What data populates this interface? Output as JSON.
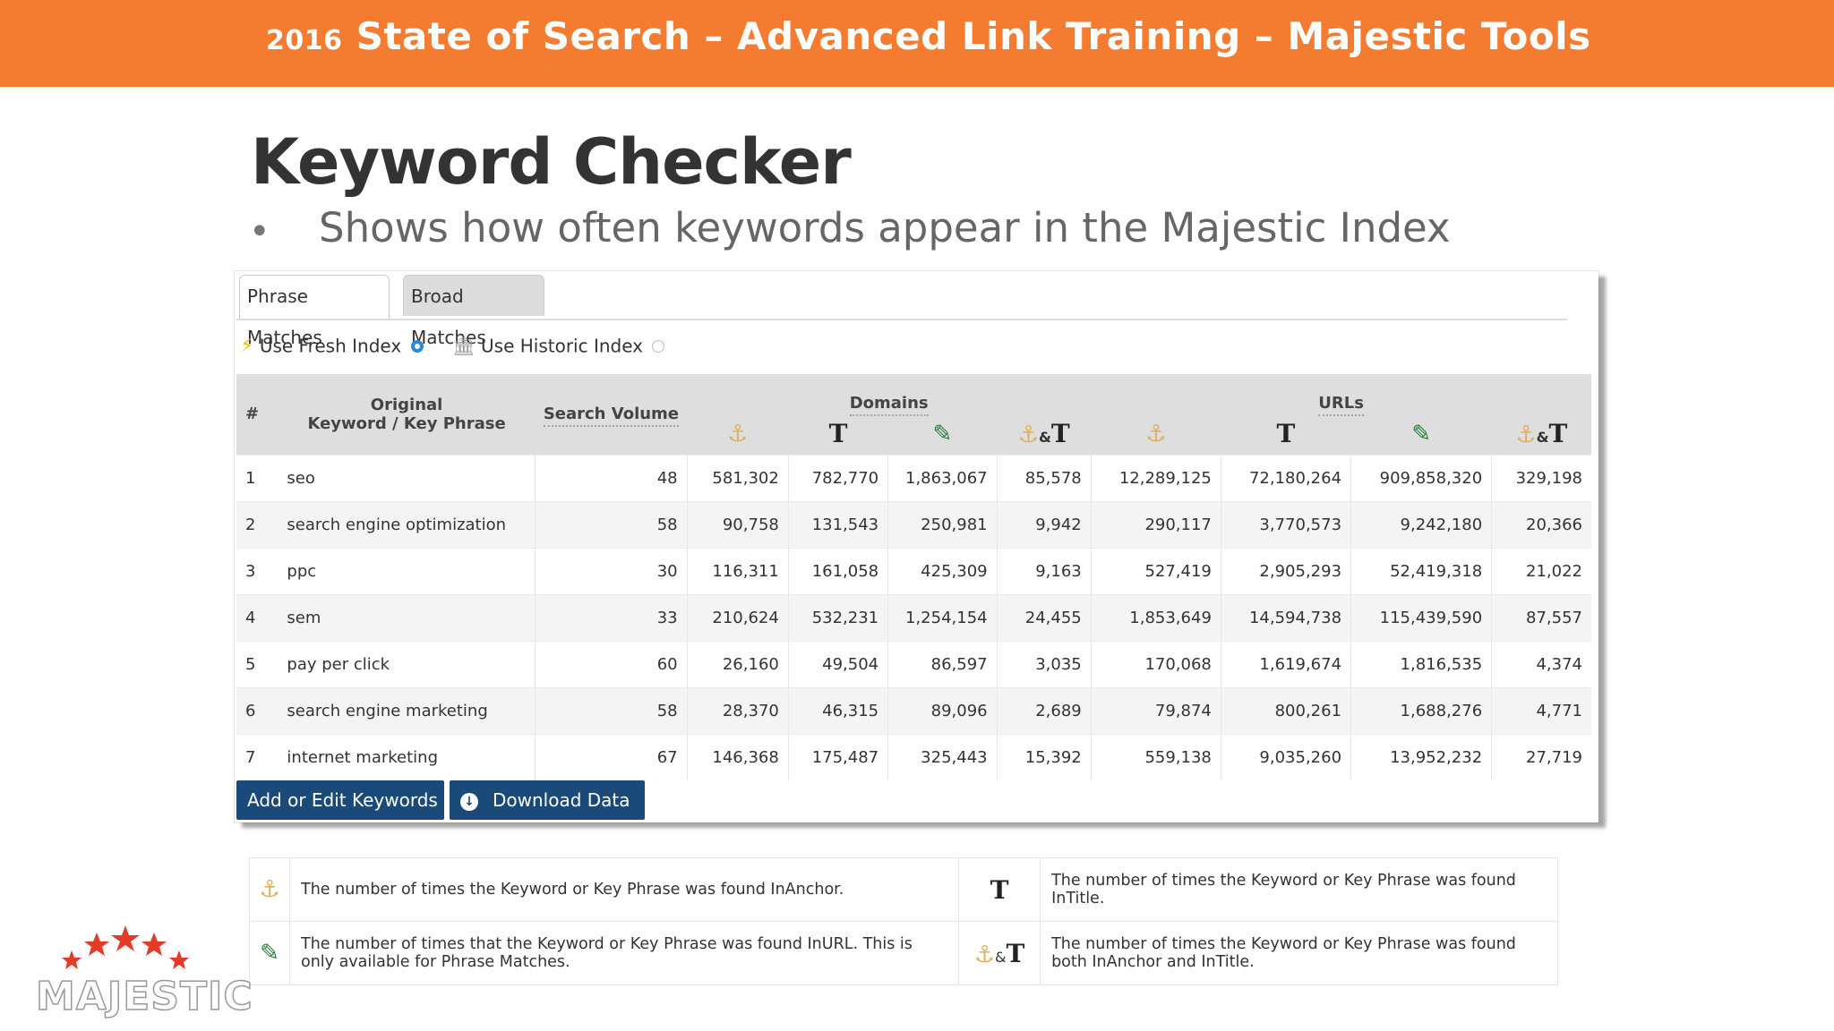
{
  "banner": {
    "year": "2016",
    "title": "State of Search – Advanced Link Training – Majestic Tools",
    "color": "#f47c30"
  },
  "slide": {
    "title": "Keyword Checker",
    "bullet": "Shows how often keywords appear in the Majestic Index"
  },
  "tabs": [
    {
      "label": "Phrase Matches",
      "active": true
    },
    {
      "label": "Broad Matches",
      "active": false
    }
  ],
  "index_options": {
    "fresh_label": "Use Fresh Index",
    "fresh_selected": true,
    "historic_label": "Use Historic Index",
    "historic_selected": false
  },
  "table": {
    "headers": {
      "num": "#",
      "keyword_line1": "Original",
      "keyword_line2": "Keyword / Key Phrase",
      "volume": "Search Volume",
      "domains": "Domains",
      "urls": "URLs",
      "amp": "&"
    },
    "rows": [
      {
        "n": "1",
        "kw": "seo",
        "vol": "48",
        "d1": "581,302",
        "d2": "782,770",
        "d3": "1,863,067",
        "d4": "85,578",
        "u1": "12,289,125",
        "u2": "72,180,264",
        "u3": "909,858,320",
        "u4": "329,198"
      },
      {
        "n": "2",
        "kw": "search engine optimization",
        "vol": "58",
        "d1": "90,758",
        "d2": "131,543",
        "d3": "250,981",
        "d4": "9,942",
        "u1": "290,117",
        "u2": "3,770,573",
        "u3": "9,242,180",
        "u4": "20,366"
      },
      {
        "n": "3",
        "kw": "ppc",
        "vol": "30",
        "d1": "116,311",
        "d2": "161,058",
        "d3": "425,309",
        "d4": "9,163",
        "u1": "527,419",
        "u2": "2,905,293",
        "u3": "52,419,318",
        "u4": "21,022"
      },
      {
        "n": "4",
        "kw": "sem",
        "vol": "33",
        "d1": "210,624",
        "d2": "532,231",
        "d3": "1,254,154",
        "d4": "24,455",
        "u1": "1,853,649",
        "u2": "14,594,738",
        "u3": "115,439,590",
        "u4": "87,557"
      },
      {
        "n": "5",
        "kw": "pay per click",
        "vol": "60",
        "d1": "26,160",
        "d2": "49,504",
        "d3": "86,597",
        "d4": "3,035",
        "u1": "170,068",
        "u2": "1,619,674",
        "u3": "1,816,535",
        "u4": "4,374"
      },
      {
        "n": "6",
        "kw": "search engine marketing",
        "vol": "58",
        "d1": "28,370",
        "d2": "46,315",
        "d3": "89,096",
        "d4": "2,689",
        "u1": "79,874",
        "u2": "800,261",
        "u3": "1,688,276",
        "u4": "4,771"
      },
      {
        "n": "7",
        "kw": "internet marketing",
        "vol": "67",
        "d1": "146,368",
        "d2": "175,487",
        "d3": "325,443",
        "d4": "15,392",
        "u1": "559,138",
        "u2": "9,035,260",
        "u3": "13,952,232",
        "u4": "27,719"
      }
    ]
  },
  "buttons": {
    "edit": "Add or Edit Keywords",
    "download": "Download Data"
  },
  "legend": {
    "anchor": "The number of times the Keyword or Key Phrase was found InAnchor.",
    "title": "The number of times the Keyword or Key Phrase was found InTitle.",
    "url": "The number of times that the Keyword or Key Phrase was found InURL. This is only available for Phrase Matches.",
    "both": "The number of times the Keyword or Key Phrase was found both InAnchor and InTitle."
  },
  "logo": {
    "text": "MAJESTIC"
  },
  "icons": {
    "anchor": "anchor-icon",
    "title": "title-T-icon",
    "url": "url-pen-icon",
    "fresh": "lightning-icon",
    "historic": "bank-icon",
    "download": "download-icon"
  }
}
